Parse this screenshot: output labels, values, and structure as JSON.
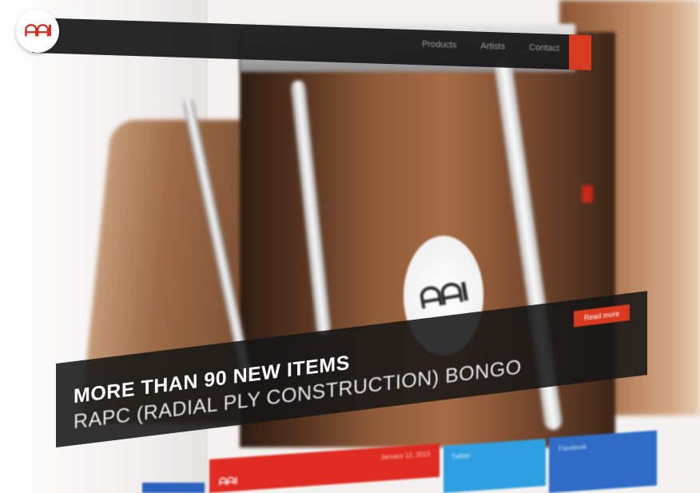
{
  "brand": {
    "logo_text": "ᗩᗩI",
    "accent_color": "#d63a1f",
    "dark_bar_color": "#1e1e1e"
  },
  "nav": {
    "items": [
      {
        "label": "Products"
      },
      {
        "label": "Artists"
      },
      {
        "label": "Contact"
      }
    ]
  },
  "hero": {
    "title": "MORE THAN 90 NEW ITEMS",
    "subtitle": "RAPC (RADIAL PLY CONSTRUCTION) BONGO",
    "cta_label": "Read more",
    "badge_text": "ᗩᗩI"
  },
  "tiles": [
    {
      "color": "#2b62c0",
      "text": ""
    },
    {
      "color": "#e02b22",
      "logo": "ᗩᗩI",
      "text": "January 12, 2013"
    },
    {
      "color": "#2e9fe0",
      "text": "Twitter"
    },
    {
      "color": "#2e6cc7",
      "text": "Facebook"
    }
  ]
}
